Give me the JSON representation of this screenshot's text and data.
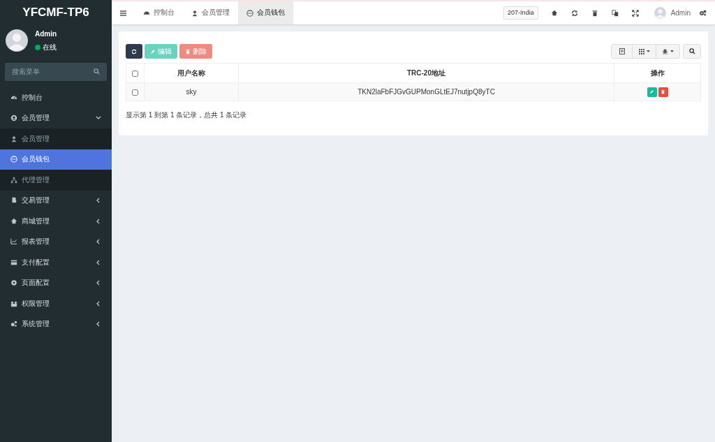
{
  "sidebar": {
    "logo": "YFCMF-TP6",
    "user": {
      "name": "Admin",
      "status": "在线",
      "online": true
    },
    "search": {
      "placeholder": "搜索菜单"
    },
    "items": [
      {
        "label": "控制台"
      },
      {
        "label": "会员管理",
        "expanded": true,
        "children": [
          {
            "label": "会员管理",
            "selected": false
          },
          {
            "label": "会员钱包",
            "selected": true
          },
          {
            "label": "代理管理",
            "selected": false
          }
        ]
      },
      {
        "label": "交易管理",
        "expanded": false
      },
      {
        "label": "商城管理",
        "expanded": false
      },
      {
        "label": "报表管理",
        "expanded": false
      },
      {
        "label": "支付配置",
        "expanded": false
      },
      {
        "label": "页面配置",
        "expanded": false
      },
      {
        "label": "权限管理",
        "expanded": false
      },
      {
        "label": "系统管理",
        "expanded": false
      }
    ]
  },
  "topbar": {
    "tabs": [
      {
        "label": "控制台",
        "selected": false
      },
      {
        "label": "会员管理",
        "selected": false
      },
      {
        "label": "会员钱包",
        "selected": true
      }
    ],
    "site_badge": "207-India",
    "user": "Admin"
  },
  "toolbar": {
    "buttons": [
      {
        "kind": "refresh",
        "disabled": false
      },
      {
        "kind": "edit",
        "label": "编辑",
        "disabled": true
      },
      {
        "kind": "delete",
        "label": "删除",
        "disabled": true
      }
    ]
  },
  "table": {
    "columns": [
      "用户名称",
      "TRC-20地址",
      "操作"
    ],
    "header_checked": false,
    "rows": [
      {
        "checked": false,
        "cells": [
          "sky",
          "TKN2laFbFJGvGUPMonGLtEJ7nutjpQ8yTC"
        ]
      }
    ]
  },
  "pagination_info": "显示第 1 到第 1 条记录，总共 1 条记录"
}
